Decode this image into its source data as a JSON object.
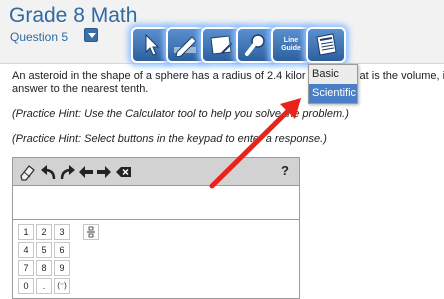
{
  "header": {
    "title": "Grade 8 Math",
    "question_label": "Question 5",
    "tools": [
      {
        "icon": "pointer-icon"
      },
      {
        "icon": "highlighter-icon"
      },
      {
        "icon": "notepad-icon"
      },
      {
        "icon": "magnifier-icon"
      },
      {
        "icon": "line-guide-icon",
        "label_line1": "Line",
        "label_line2": "Guide"
      },
      {
        "icon": "calculator-icon"
      }
    ],
    "calculator_menu": {
      "options": [
        "Basic",
        "Scientific"
      ],
      "highlighted": "Scientific"
    }
  },
  "question": {
    "line1": "An asteroid in the shape of a sphere has a radius of 2.4 kilor",
    "line1_tail": "at is the volume, i",
    "line2": "answer to the nearest tenth.",
    "hint1": "(Practice Hint: Use the Calculator tool to help you solve the problem.)",
    "hint2": "(Practice Hint: Select buttons in the keypad to enter a response.)"
  },
  "response": {
    "help": "?",
    "toolbar_icons": [
      "eraser-icon",
      "undo-icon",
      "redo-icon",
      "left-arrow-icon",
      "right-arrow-icon",
      "backspace-icon"
    ],
    "keypad": [
      [
        "1",
        "2",
        "3"
      ],
      [
        "4",
        "5",
        "6"
      ],
      [
        "7",
        "8",
        "9"
      ],
      [
        "0",
        ".",
        "(⁻)"
      ]
    ]
  },
  "colors": {
    "title": "#2f6aa3",
    "tool_button": "#2d5f9e",
    "tool_glow": "#8fc0ff",
    "annotation_arrow": "#e8231a",
    "menu_highlight": "#4a7fc7"
  }
}
